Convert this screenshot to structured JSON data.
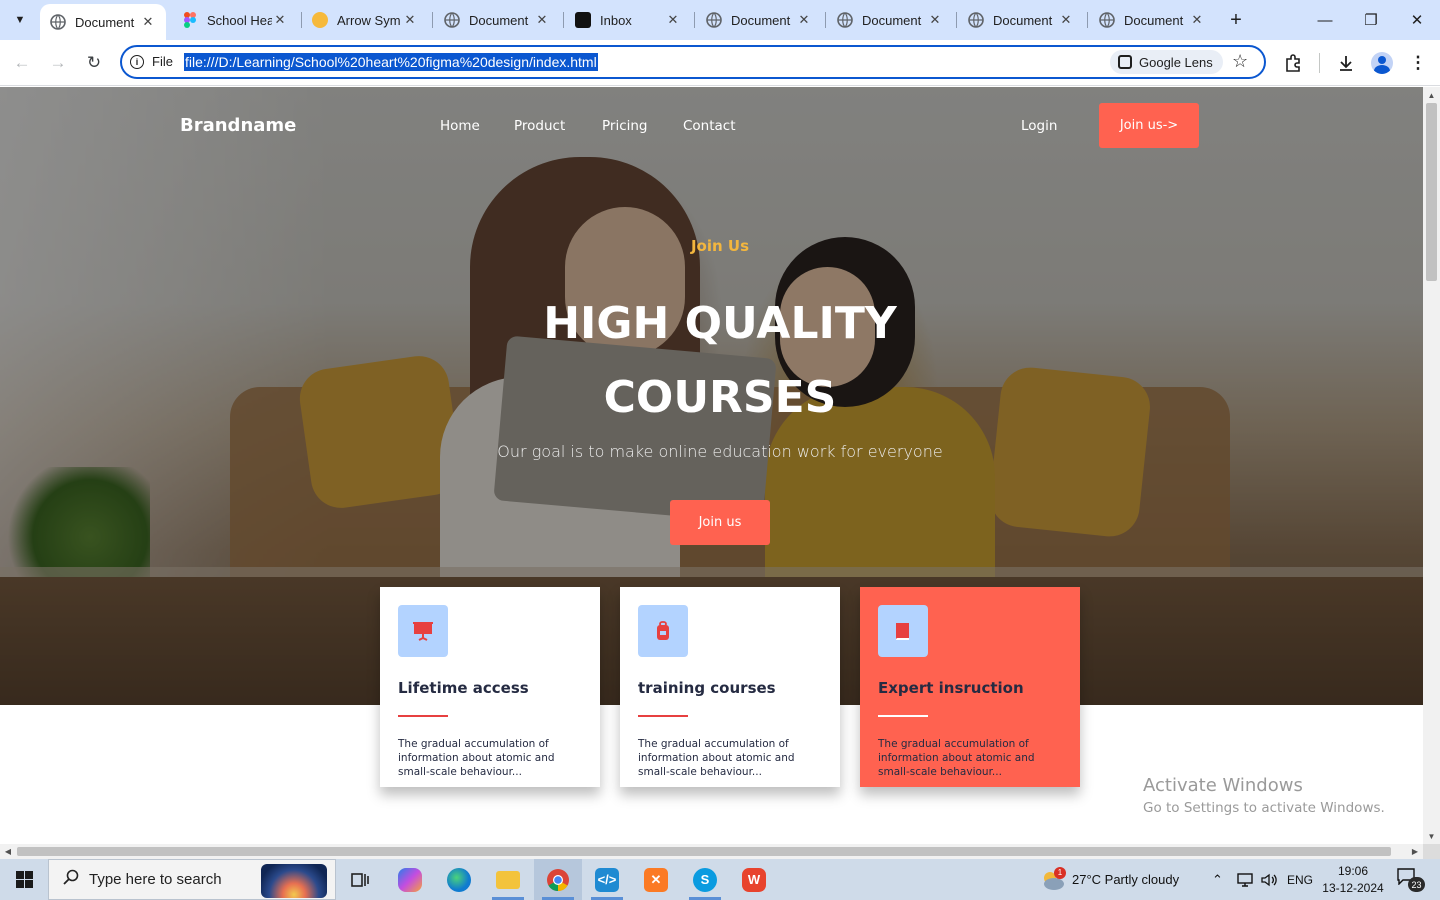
{
  "browser": {
    "tabs": [
      {
        "title": "Document",
        "favicon": "globe-icon",
        "active": true
      },
      {
        "title": "School Hea",
        "favicon": "figma-icon",
        "active": false
      },
      {
        "title": "Arrow Sym",
        "favicon": "emoji-icon",
        "active": false
      },
      {
        "title": "Document",
        "favicon": "globe-icon",
        "active": false
      },
      {
        "title": "Inbox",
        "favicon": "inbox-icon",
        "active": false
      },
      {
        "title": "Document",
        "favicon": "globe-icon",
        "active": false
      },
      {
        "title": "Document",
        "favicon": "globe-icon",
        "active": false
      },
      {
        "title": "Document",
        "favicon": "globe-icon",
        "active": false
      },
      {
        "title": "Document",
        "favicon": "globe-icon",
        "active": false
      }
    ],
    "address": {
      "scheme_label": "File",
      "url": "file:///D:/Learning/School%20heart%20figma%20design/index.html",
      "lens_label": "Google Lens"
    }
  },
  "site": {
    "brand": "Brandname",
    "nav": [
      "Home",
      "Product",
      "Pricing",
      "Contact"
    ],
    "login": "Login",
    "join_top": "Join us->",
    "hero": {
      "eyebrow": "Join Us",
      "headline_line1": "HIGH QUALITY",
      "headline_line2": "COURSES",
      "subtitle": "Our goal is to make online education work for everyone",
      "cta": "Join us"
    },
    "cards": [
      {
        "title": "Lifetime access",
        "icon": "presentation-icon",
        "desc": "The gradual accumulation of information about atomic and small-scale behaviour...",
        "highlighted": false
      },
      {
        "title": "training courses",
        "icon": "backpack-icon",
        "desc": "The gradual accumulation of information about atomic and small-scale behaviour...",
        "highlighted": false
      },
      {
        "title": "Expert insruction",
        "icon": "book-icon",
        "desc": "The gradual accumulation of information about atomic and small-scale behaviour...",
        "highlighted": true
      }
    ]
  },
  "watermark": {
    "line1": "Activate Windows",
    "line2": "Go to Settings to activate Windows."
  },
  "taskbar": {
    "search_placeholder": "Type here to search",
    "weather": "27°C  Partly cloudy",
    "language": "ENG",
    "time": "19:06",
    "date": "13-12-2024",
    "notification_count": "23",
    "weather_badge": "1"
  },
  "colors": {
    "accent": "#ff6250",
    "eyebrow": "#f3b63e",
    "icon_bg": "#b3d3ff",
    "tab_strip": "#d3e3fd",
    "focus_blue": "#0b57d0"
  }
}
